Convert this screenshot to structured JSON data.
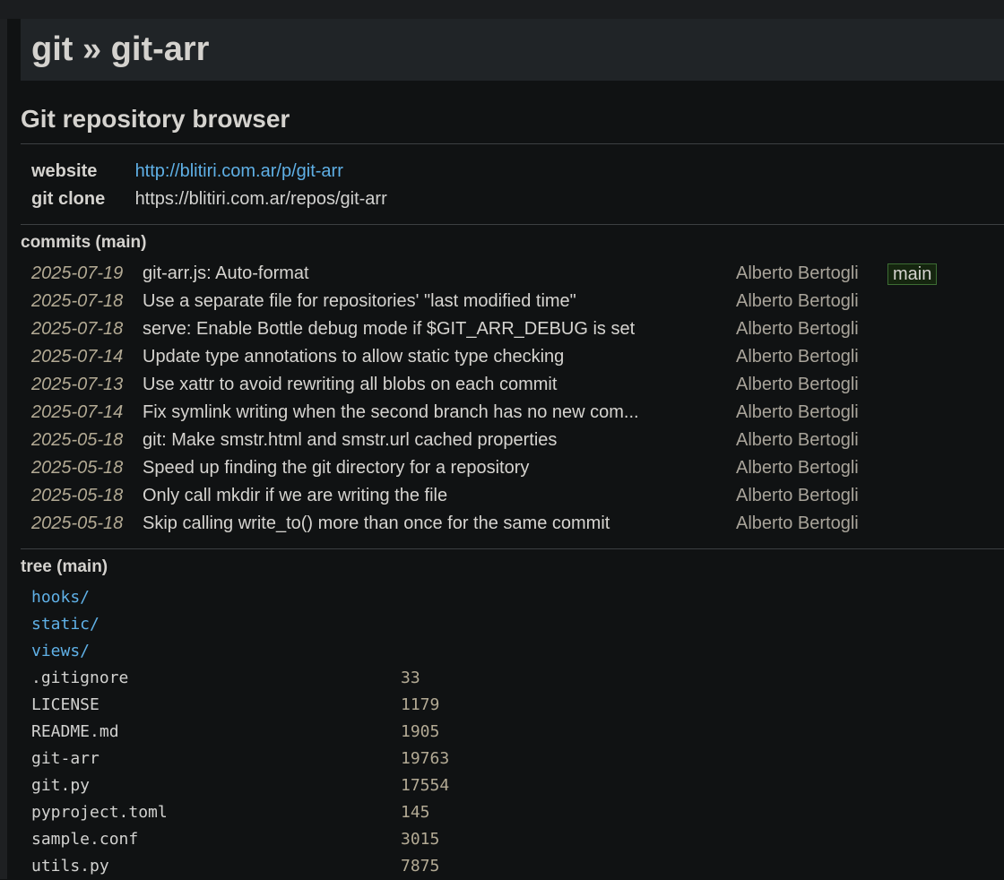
{
  "header": {
    "title": "git » git-arr"
  },
  "repo": {
    "description": "Git repository browser",
    "website_label": "website",
    "website_url": "http://blitiri.com.ar/p/git-arr",
    "clone_label": "git clone",
    "clone_url": "https://blitiri.com.ar/repos/git-arr"
  },
  "commits": {
    "title": "commits (main)",
    "rows": [
      {
        "date": "2025-07-19",
        "message": "git-arr.js: Auto-format",
        "author": "Alberto Bertogli",
        "badge": "main"
      },
      {
        "date": "2025-07-18",
        "message": "Use a separate file for repositories' \"last modified time\"",
        "author": "Alberto Bertogli",
        "badge": ""
      },
      {
        "date": "2025-07-18",
        "message": "serve: Enable Bottle debug mode if $GIT_ARR_DEBUG is set",
        "author": "Alberto Bertogli",
        "badge": ""
      },
      {
        "date": "2025-07-14",
        "message": "Update type annotations to allow static type checking",
        "author": "Alberto Bertogli",
        "badge": ""
      },
      {
        "date": "2025-07-13",
        "message": "Use xattr to avoid rewriting all blobs on each commit",
        "author": "Alberto Bertogli",
        "badge": ""
      },
      {
        "date": "2025-07-14",
        "message": "Fix symlink writing when the second branch has no new com...",
        "author": "Alberto Bertogli",
        "badge": ""
      },
      {
        "date": "2025-05-18",
        "message": "git: Make smstr.html and smstr.url cached properties",
        "author": "Alberto Bertogli",
        "badge": ""
      },
      {
        "date": "2025-05-18",
        "message": "Speed up finding the git directory for a repository",
        "author": "Alberto Bertogli",
        "badge": ""
      },
      {
        "date": "2025-05-18",
        "message": "Only call mkdir if we are writing the file",
        "author": "Alberto Bertogli",
        "badge": ""
      },
      {
        "date": "2025-05-18",
        "message": "Skip calling write_to() more than once for the same commit",
        "author": "Alberto Bertogli",
        "badge": ""
      }
    ]
  },
  "tree": {
    "title": "tree (main)",
    "entries": [
      {
        "name": "hooks/",
        "size": "",
        "is_dir": true
      },
      {
        "name": "static/",
        "size": "",
        "is_dir": true
      },
      {
        "name": "views/",
        "size": "",
        "is_dir": true
      },
      {
        "name": ".gitignore",
        "size": "33",
        "is_dir": false
      },
      {
        "name": "LICENSE",
        "size": "1179",
        "is_dir": false
      },
      {
        "name": "README.md",
        "size": "1905",
        "is_dir": false
      },
      {
        "name": "git-arr",
        "size": "19763",
        "is_dir": false
      },
      {
        "name": "git.py",
        "size": "17554",
        "is_dir": false
      },
      {
        "name": "pyproject.toml",
        "size": "145",
        "is_dir": false
      },
      {
        "name": "sample.conf",
        "size": "3015",
        "is_dir": false
      },
      {
        "name": "utils.py",
        "size": "7875",
        "is_dir": false
      }
    ]
  },
  "colors": {
    "background": "#101213",
    "link": "#5fb0e6",
    "date": "#b3aa94",
    "badge_border": "#3d6d34"
  }
}
